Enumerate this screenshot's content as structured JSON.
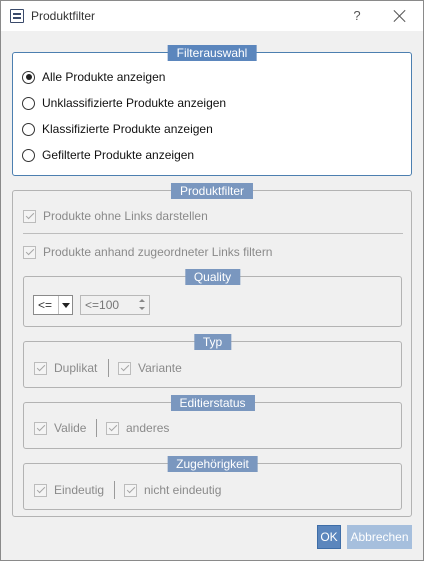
{
  "window": {
    "title": "Produktfilter",
    "help_label": "?"
  },
  "filterauswahl": {
    "legend": "Filterauswahl",
    "options": [
      {
        "label": "Alle Produkte anzeigen",
        "checked": true
      },
      {
        "label": "Unklassifizierte Produkte anzeigen",
        "checked": false
      },
      {
        "label": "Klassifizierte Produkte anzeigen",
        "checked": false
      },
      {
        "label": "Gefilterte Produkte anzeigen",
        "checked": false
      }
    ]
  },
  "produktfilter": {
    "legend": "Produktfilter",
    "ohne_links": {
      "label": "Produkte ohne Links darstellen",
      "checked": true
    },
    "links_filtern": {
      "label": "Produkte anhand zugeordneter Links filtern",
      "checked": true
    },
    "quality": {
      "legend": "Quality",
      "operator": "<=",
      "value": "<=100"
    },
    "typ": {
      "legend": "Typ",
      "items": [
        {
          "label": "Duplikat",
          "checked": true
        },
        {
          "label": "Variante",
          "checked": true
        }
      ]
    },
    "editierstatus": {
      "legend": "Editierstatus",
      "items": [
        {
          "label": "Valide",
          "checked": true
        },
        {
          "label": "anderes",
          "checked": true
        }
      ]
    },
    "zugehoerigkeit": {
      "legend": "Zugehörigkeit",
      "items": [
        {
          "label": "Eindeutig",
          "checked": true
        },
        {
          "label": "nicht eindeutig",
          "checked": true
        }
      ]
    }
  },
  "buttons": {
    "ok": "OK",
    "cancel": "Abbrechen"
  },
  "colors": {
    "accent": "#5b86bd",
    "legend_disabled": "#7a97bf",
    "button_disabled": "#a6bfdd"
  }
}
